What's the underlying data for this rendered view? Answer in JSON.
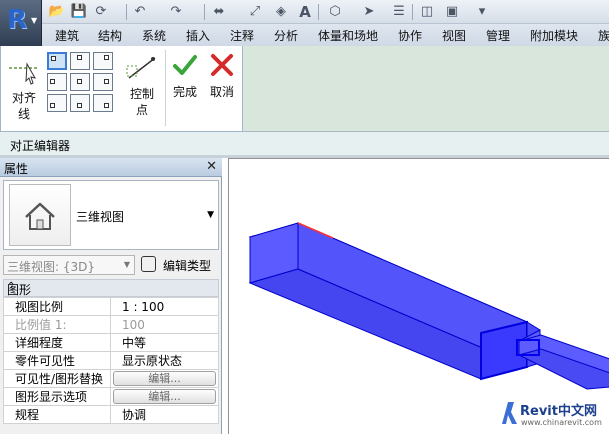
{
  "quick_access": {
    "icons": [
      "open-icon",
      "save-icon",
      "sync-icon",
      "undo-icon",
      "redo-icon",
      "measure-icon",
      "dimension-icon",
      "tag-icon",
      "text-icon",
      "3d-view-icon",
      "section-icon",
      "thin-lines-icon",
      "close-windows-icon",
      "switch-windows-icon",
      "customize-icon"
    ],
    "text_button": "A"
  },
  "tabs": [
    "建筑",
    "结构",
    "系统",
    "插入",
    "注释",
    "分析",
    "体量和场地",
    "协作",
    "视图",
    "管理",
    "附加模块",
    "族"
  ],
  "ribbon": {
    "align_line_label": [
      "对齐",
      "线"
    ],
    "control_point_label": [
      "控制",
      "点"
    ],
    "finish_label": "完成",
    "cancel_label": "取消",
    "colors": {
      "finish": "#3aa53a",
      "cancel": "#d42a2a",
      "panel_bg": "#d8e6dc"
    }
  },
  "context_bar": {
    "title": "对正编辑器"
  },
  "properties": {
    "title": "属性",
    "close_glyph": "✕",
    "type_name": "三维视图",
    "view_selector": "三维视图: {3D}",
    "edit_type": "编辑类型",
    "group_label": "图形",
    "rows": [
      {
        "key": "视图比例",
        "value": "1 : 100"
      },
      {
        "key": "比例值 1:",
        "value": "100"
      },
      {
        "key": "详细程度",
        "value": "中等"
      },
      {
        "key": "零件可见性",
        "value": "显示原状态"
      },
      {
        "key": "可见性/图形替换",
        "value": "编辑..."
      },
      {
        "key": "图形显示选项",
        "value": "编辑..."
      },
      {
        "key": "规程",
        "value": "协调"
      }
    ]
  },
  "viewport": {
    "duct_color": "#4a4aff",
    "outline_color": "#0000cc",
    "highlight_color": "#ff3030"
  },
  "watermark": {
    "brand": "Revit中文网",
    "url": "www.chinarevit.com"
  }
}
